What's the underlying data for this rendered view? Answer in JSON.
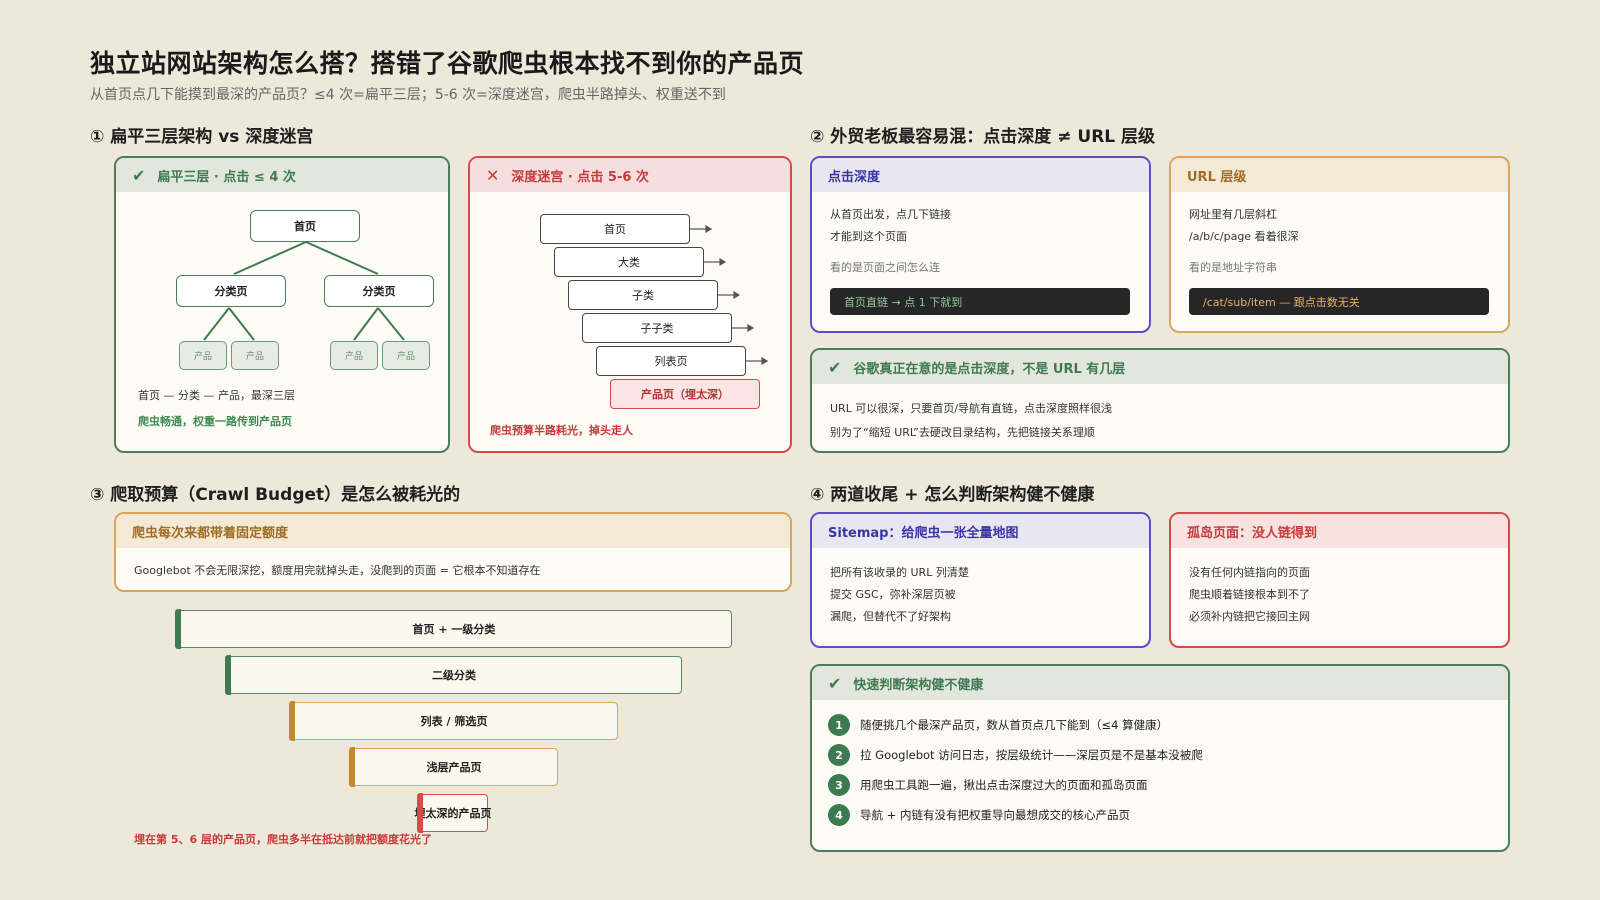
{
  "title": "独立站网站架构怎么搭？搭错了谷歌爬虫根本找不到你的产品页",
  "subtitle": "从首页点几下能摸到最深的产品页？≤4 次=扁平三层；5-6 次=深度迷宫，爬虫半路掉头、权重送不到",
  "s1": {
    "heading": "① 扁平三层架构 vs 深度迷宫",
    "flat": {
      "header": "扁平三层 · 点击 ≤ 4 次",
      "root": "首页",
      "cat1": "分类页",
      "cat2": "分类页",
      "p1": "产品",
      "p2": "产品",
      "p3": "产品",
      "p4": "产品",
      "desc": "首页 — 分类 — 产品，最深三层",
      "note": "爬虫畅通，权重一路传到产品页"
    },
    "deep": {
      "header": "深度迷宫 · 点击 5-6 次",
      "steps": [
        "首页",
        "大类",
        "子类",
        "子子类",
        "列表页"
      ],
      "last": "产品页（埋太深）",
      "note": "爬虫预算半路耗光，掉头走人"
    }
  },
  "s2": {
    "heading": "② 外贸老板最容易混：点击深度 ≠ URL 层级",
    "click": {
      "header": "点击深度",
      "l1": "从首页出发，点几下链接",
      "l2": "才能到这个页面",
      "l3": "看的是页面之间怎么连",
      "bar": "首页直链 → 点 1 下就到"
    },
    "url": {
      "header": "URL 层级",
      "l1": "网址里有几层斜杠",
      "l2": "/a/b/c/page 看着很深",
      "l3": "看的是地址字符串",
      "bar": "/cat/sub/item — 跟点击数无关"
    },
    "google": {
      "header": "谷歌真正在意的是点击深度，不是 URL 有几层",
      "l1": "URL 可以很深，只要首页/导航有直链，点击深度照样很浅",
      "l2": "别为了“缩短 URL”去硬改目录结构，先把链接关系理顺"
    }
  },
  "s3": {
    "heading": "③ 爬取预算（Crawl Budget）是怎么被耗光的",
    "card": {
      "header": "爬虫每次来都带着固定额度",
      "l1": "Googlebot 不会无限深挖，额度用完就掉头走，没爬到的页面 = 它根本不知道存在"
    },
    "funnel": [
      "首页 + 一级分类",
      "二级分类",
      "列表 / 筛选页",
      "浅层产品页",
      "埋太深的产品页"
    ],
    "note": "埋在第 5、6 层的产品页，爬虫多半在抵达前就把额度花光了"
  },
  "s4": {
    "heading": "④ 两道收尾 + 怎么判断架构健不健康",
    "sitemap": {
      "header": "Sitemap：给爬虫一张全量地图",
      "l1": "把所有该收录的 URL 列清楚",
      "l2": "提交 GSC，弥补深层页被",
      "l3": "漏爬，但替代不了好架构"
    },
    "orphan": {
      "header": "孤岛页面：没人链得到",
      "l1": "没有任何内链指向的页面",
      "l2": "爬虫顺着链接根本到不了",
      "l3": "必须补内链把它接回主网"
    },
    "check": {
      "header": "快速判断架构健不健康",
      "items": [
        {
          "n": "1",
          "t": "随便挑几个最深产品页，数从首页点几下能到（≤4 算健康）"
        },
        {
          "n": "2",
          "t": "拉 Googlebot 访问日志，按层级统计——深层页是不是基本没被爬"
        },
        {
          "n": "3",
          "t": "用爬虫工具跑一遍，揪出点击深度过大的页面和孤岛页面"
        },
        {
          "n": "4",
          "t": "导航 + 内链有没有把权重导向最想成交的核心产品页"
        }
      ]
    }
  },
  "colors": {
    "bg": "#ede8da",
    "green": "#4a7e5a",
    "red": "#d54a4a",
    "blue": "#5b4fc9",
    "gold": "#d9a55a",
    "dark": "#262626"
  },
  "icons": {
    "check": "check-icon",
    "cross": "cross-icon"
  }
}
